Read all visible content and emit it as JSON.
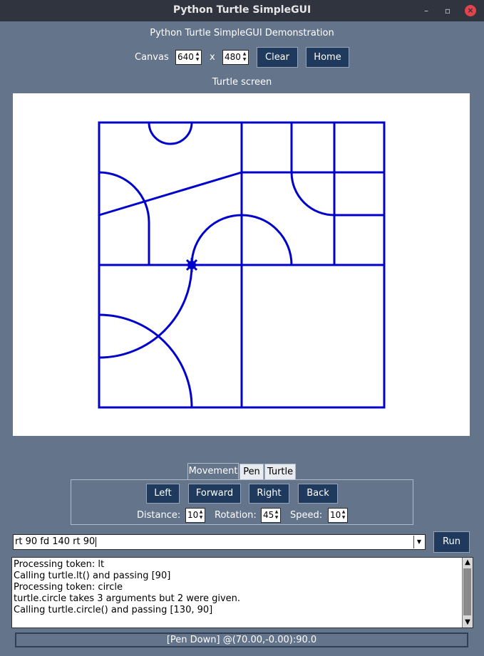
{
  "window": {
    "title": "Python Turtle SimpleGUI"
  },
  "header": {
    "demo_title": "Python Turtle SimpleGUI Demonstration"
  },
  "canvas_controls": {
    "label": "Canvas",
    "width": "640",
    "separator": "x",
    "height": "480",
    "clear_label": "Clear",
    "home_label": "Home"
  },
  "turtle_screen": {
    "label": "Turtle screen",
    "pen_color": "#0000cc"
  },
  "tabs": [
    {
      "label": "Movement",
      "active": true
    },
    {
      "label": "Pen",
      "active": false
    },
    {
      "label": "Turtle",
      "active": false
    }
  ],
  "movement": {
    "left_label": "Left",
    "forward_label": "Forward",
    "right_label": "Right",
    "back_label": "Back",
    "distance_label": "Distance:",
    "distance_value": "10",
    "rotation_label": "Rotation:",
    "rotation_value": "45",
    "speed_label": "Speed:",
    "speed_value": "10"
  },
  "command": {
    "value": "rt 90 fd 140 rt 90",
    "run_label": "Run"
  },
  "log": {
    "lines": [
      "Processing token: lt",
      "Calling turtle.lt() and passing [90]",
      "Processing token: circle",
      "turtle.circle takes 3 arguments but 2 were given.",
      "Calling turtle.circle() and passing [130, 90]"
    ]
  },
  "status": {
    "text": "[Pen Down] @(70.00,-0.00):90.0"
  },
  "colors": {
    "background": "#64748b",
    "titlebar": "#2f343f",
    "button": "#1f3a5c",
    "close": "#e4434d"
  }
}
